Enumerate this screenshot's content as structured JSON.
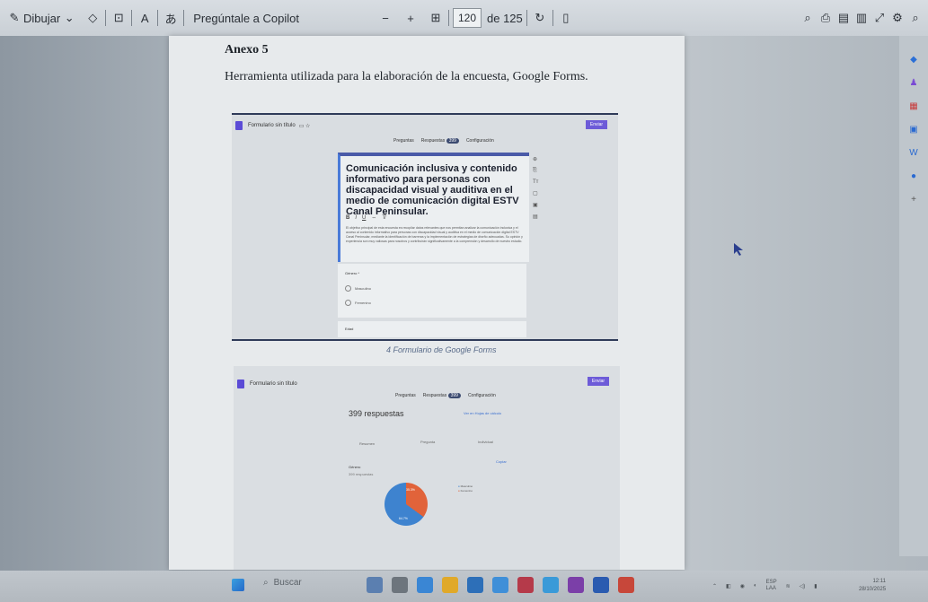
{
  "toolbar": {
    "draw_label": "Dibujar",
    "copilot_label": "Pregúntale a Copilot",
    "page_current": "120",
    "page_total": "de 125",
    "minus": "−",
    "plus": "+"
  },
  "document": {
    "annex_title": "Anexo 5",
    "annex_description": "Herramienta utilizada para la elaboración de la encuesta, Google Forms.",
    "caption": "4 Formulario de Google Forms"
  },
  "form1": {
    "doc_title": "Formulario sin título",
    "send_label": "Enviar",
    "tabs": [
      "Preguntas",
      "Respuestas",
      "Configuración"
    ],
    "responses_badge": "399",
    "title": "Comunicación inclusiva y contenido informativo para personas con discapacidad visual y auditiva en el medio de comunicación digital ESTV Canal Peninsular.",
    "format_buttons": [
      "B",
      "I",
      "U",
      "⇔",
      "T̸"
    ],
    "description": "El objetivo principal de esta encuesta es recopilar datos relevantes que nos permitan analizar la comunicación inclusiva y el acceso al contenido informativo para personas con discapacidad visual y auditiva en el medio de comunicación digital ESTV Canal Peninsular, mediante la identificación de barreras y la implementación de estrategias de diseño adecuadas. Su opinión y experiencia son muy valiosas para nosotros y contribuirán significativamente a la comprensión y desarrollo de nuestro estudio.",
    "question_label": "Género *",
    "options": [
      "Masculino",
      "Femenino"
    ],
    "question2_label": "Edad"
  },
  "form2": {
    "doc_title": "Formulario sin título",
    "send_label": "Enviar",
    "tabs": [
      "Preguntas",
      "Respuestas",
      "Configuración"
    ],
    "responses_badge": "399",
    "responses_count": "399 respuestas",
    "link_sheets": "Ver en Hojas de cálculo",
    "sub_tabs": [
      "Resumen",
      "Pregunta",
      "Individual"
    ],
    "copy_label": "Copiar",
    "question_label": "Género",
    "question_sub": "399 respuestas",
    "pie_labels": [
      "35.3%",
      "64.7%"
    ],
    "legend": [
      "Masculino",
      "Femenino"
    ],
    "colors": {
      "slice_a": "#e1633a",
      "slice_b": "#3e83cf"
    }
  },
  "taskbar": {
    "search_placeholder": "Buscar",
    "lang_top": "ESP",
    "lang_bottom": "LAA",
    "time": "12:11",
    "date": "28/10/2025"
  }
}
